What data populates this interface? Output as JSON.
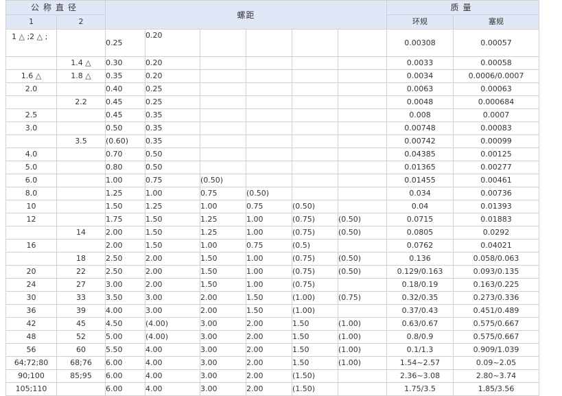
{
  "header": {
    "nominal_diameter": "公称直径",
    "pitch": "螺距",
    "mass": "质量",
    "col1": "1",
    "col2": "2",
    "ring_gauge": "环规",
    "plug_gauge": "塞规"
  },
  "rows": [
    {
      "d1": "1 △ ;2 △ ;",
      "d2": "",
      "p": [
        "0.25",
        "0.20",
        "",
        "",
        "",
        ""
      ],
      "ring": "0.00308",
      "plug": "0.00057"
    },
    {
      "d1": "",
      "d2": "1.4 △",
      "p": [
        "0.30",
        "0.20",
        "",
        "",
        "",
        ""
      ],
      "ring": "0.0033",
      "plug": "0.00058"
    },
    {
      "d1": "1.6 △",
      "d2": "1.8 △",
      "p": [
        "0.35",
        "0.20",
        "",
        "",
        "",
        ""
      ],
      "ring": "0.0034",
      "plug": "0.0006/0.0007"
    },
    {
      "d1": "2.0",
      "d2": "",
      "p": [
        "0.40",
        "0.25",
        "",
        "",
        "",
        ""
      ],
      "ring": "0.0063",
      "plug": "0.00063"
    },
    {
      "d1": "",
      "d2": "2.2",
      "p": [
        "0.45",
        "0.25",
        "",
        "",
        "",
        ""
      ],
      "ring": "0.0048",
      "plug": "0.000684"
    },
    {
      "d1": "2.5",
      "d2": "",
      "p": [
        "0.45",
        "0.35",
        "",
        "",
        "",
        ""
      ],
      "ring": "0.008",
      "plug": "0.0007"
    },
    {
      "d1": "3.0",
      "d2": "",
      "p": [
        "0.50",
        "0.35",
        "",
        "",
        "",
        ""
      ],
      "ring": "0.00748",
      "plug": "0.00083"
    },
    {
      "d1": "",
      "d2": "3.5",
      "p": [
        "(0.60)",
        "0.35",
        "",
        "",
        "",
        ""
      ],
      "ring": "0.00742",
      "plug": "0.00099"
    },
    {
      "d1": "4.0",
      "d2": "",
      "p": [
        "0.70",
        "0.50",
        "",
        "",
        "",
        ""
      ],
      "ring": "0.04385",
      "plug": "0.00125"
    },
    {
      "d1": "5.0",
      "d2": "",
      "p": [
        "0.80",
        "0.50",
        "",
        "",
        "",
        ""
      ],
      "ring": "0.01365",
      "plug": "0.00277"
    },
    {
      "d1": "6.0",
      "d2": "",
      "p": [
        "1.00",
        "0.75",
        "(0.50)",
        "",
        "",
        ""
      ],
      "ring": "0.01455",
      "plug": "0.00461"
    },
    {
      "d1": "8.0",
      "d2": "",
      "p": [
        "1.25",
        "1.00",
        "0.75",
        "(0.50)",
        "",
        ""
      ],
      "ring": "0.034",
      "plug": "0.00736"
    },
    {
      "d1": "10",
      "d2": "",
      "p": [
        "1.50",
        "1.25",
        "1.00",
        "0.75",
        "(0.50)",
        ""
      ],
      "ring": "0.04",
      "plug": "0.01393"
    },
    {
      "d1": "12",
      "d2": "",
      "p": [
        "1.75",
        "1.50",
        "1.25",
        "1.00",
        "(0.75)",
        "(0.50)"
      ],
      "ring": "0.0715",
      "plug": "0.01883"
    },
    {
      "d1": "",
      "d2": "14",
      "p": [
        "2.00",
        "1.50",
        "1.25",
        "1.00",
        "(0.75)",
        "(0.50)"
      ],
      "ring": "0.0805",
      "plug": "0.0292"
    },
    {
      "d1": "16",
      "d2": "",
      "p": [
        "2.00",
        "1.50",
        "1.00",
        "0.75",
        "(0.5)",
        ""
      ],
      "ring": "0.0762",
      "plug": "0.04021"
    },
    {
      "d1": "",
      "d2": "18",
      "p": [
        "2.50",
        "2.00",
        "1.50",
        "1.00",
        "(0.75)",
        "(0.50)"
      ],
      "ring": "0.136",
      "plug": "0.058/0.063"
    },
    {
      "d1": "20",
      "d2": "22",
      "p": [
        "2.50",
        "2.00",
        "1.50",
        "1.00",
        "(0.75)",
        "(0.50)"
      ],
      "ring": "0.129/0.163",
      "plug": "0.093/0.135"
    },
    {
      "d1": "24",
      "d2": "27",
      "p": [
        "3.00",
        "2.00",
        "1.50",
        "1.00",
        "(0.75)",
        ""
      ],
      "ring": "0.18/0.19",
      "plug": "0.163/0.225"
    },
    {
      "d1": "30",
      "d2": "33",
      "p": [
        "3.50",
        "3.00",
        "2.00",
        "1.50",
        "(1.00)",
        "(0.75)"
      ],
      "ring": "0.32/0.35",
      "plug": "0.273/0.336"
    },
    {
      "d1": "36",
      "d2": "39",
      "p": [
        "4.00",
        "3.00",
        "2.00",
        "1.50",
        "(1.00)",
        ""
      ],
      "ring": "0.37/0.43",
      "plug": "0.451/0.489"
    },
    {
      "d1": "42",
      "d2": "45",
      "p": [
        "4.50",
        "(4.00)",
        "3.00",
        "2.00",
        "1.50",
        "(1.00)"
      ],
      "ring": "0.63/0.67",
      "plug": "0.575/0.667"
    },
    {
      "d1": "48",
      "d2": "52",
      "p": [
        "5.00",
        "(4.00)",
        "3.00",
        "2.00",
        "1.50",
        "(1.00)"
      ],
      "ring": "0.8/0.9",
      "plug": "0.575/0.667"
    },
    {
      "d1": "56",
      "d2": "60",
      "p": [
        "5.50",
        "4.00",
        "3.00",
        "2.00",
        "1.50",
        "(1.00)"
      ],
      "ring": "0.1/1.3",
      "plug": "0.909/1.039"
    },
    {
      "d1": "64;72;80",
      "d2": "68;76",
      "p": [
        "6.00",
        "4.00",
        "3.00",
        "2.00",
        "1.50",
        "(1.00)"
      ],
      "ring": "1.54~2.57",
      "plug": "0.09~2.05"
    },
    {
      "d1": "90;100",
      "d2": "85;95",
      "p": [
        "6.00",
        "4.00",
        "3.00",
        "2.00",
        "(1.50)",
        ""
      ],
      "ring": "2.36~3.08",
      "plug": "2.80~3.74"
    },
    {
      "d1": "105;110",
      "d2": "",
      "p": [
        "6.00",
        "4.00",
        "3.00",
        "2.00",
        "(1.50)",
        ""
      ],
      "ring": "1.75/3.5",
      "plug": "1.85/3.56"
    }
  ]
}
